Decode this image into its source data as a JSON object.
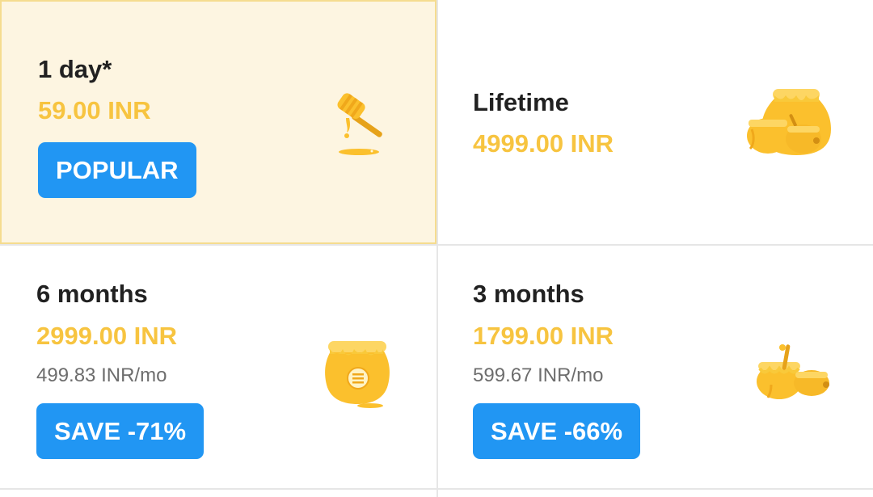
{
  "plans": [
    {
      "name": "1 day*",
      "price": "59.00 INR",
      "badge": "POPULAR",
      "icon": "honey-dipper-icon",
      "selected": true
    },
    {
      "name": "Lifetime",
      "price": "4999.00 INR",
      "icon": "honey-pots-stack-icon"
    },
    {
      "name": "6 months",
      "price": "2999.00 INR",
      "per_month": "499.83 INR/mo",
      "badge": "SAVE -71%",
      "icon": "honey-pot-icon"
    },
    {
      "name": "3 months",
      "price": "1799.00 INR",
      "per_month": "599.67 INR/mo",
      "badge": "SAVE -66%",
      "icon": "honey-pots-icon"
    }
  ],
  "colors": {
    "price": "#f7c440",
    "badge": "#2196f3",
    "selected_background": "#fdf5e1",
    "selected_border": "#f5dc8f",
    "honey": "#fbc02d"
  }
}
